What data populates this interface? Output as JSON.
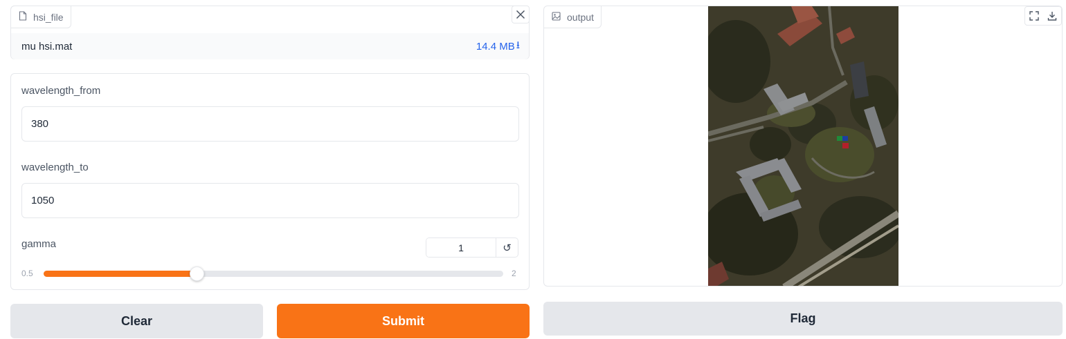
{
  "file_input": {
    "label": "hsi_file",
    "icon": "file-icon",
    "file_name": "mu hsi.mat",
    "file_size": "14.4 MB",
    "download_glyph": "⭳"
  },
  "wavelength_from": {
    "label": "wavelength_from",
    "value": "380"
  },
  "wavelength_to": {
    "label": "wavelength_to",
    "value": "1050"
  },
  "gamma": {
    "label": "gamma",
    "value": "1",
    "min": "0.5",
    "max": "2",
    "fraction": 0.3333,
    "reset_glyph": "↺"
  },
  "buttons": {
    "clear": "Clear",
    "submit": "Submit",
    "flag": "Flag"
  },
  "output": {
    "label": "output",
    "icon": "image-icon"
  },
  "colors": {
    "accent": "#f97316",
    "link": "#2563eb",
    "button_gray": "#e5e7eb",
    "border": "#e5e7eb"
  }
}
